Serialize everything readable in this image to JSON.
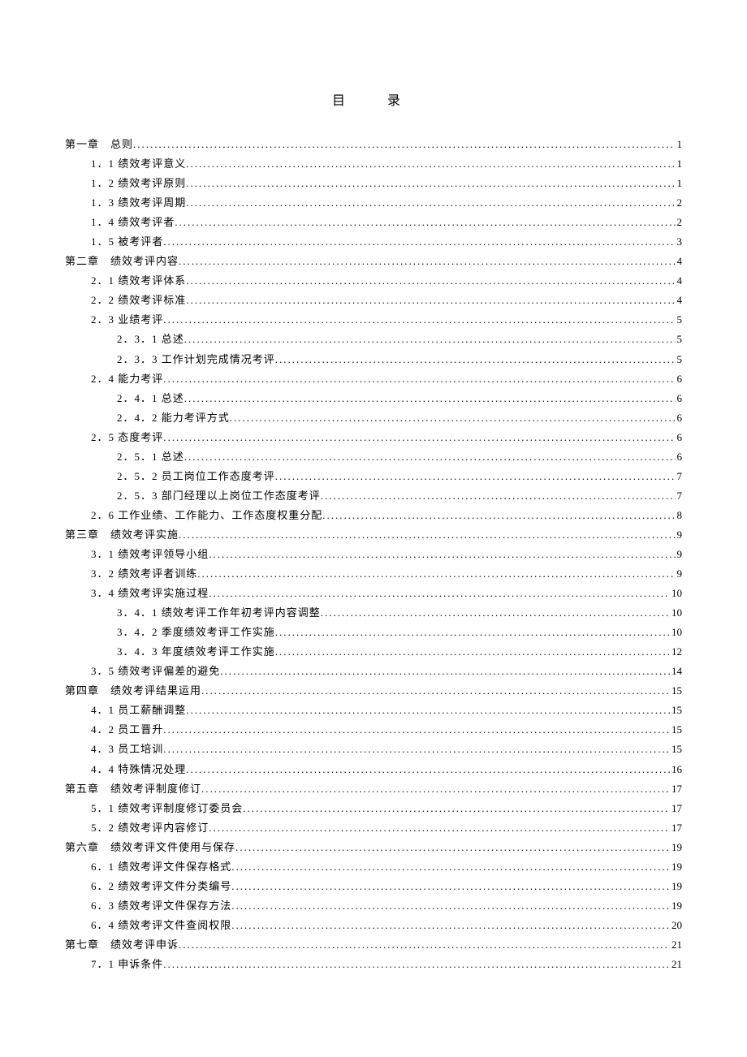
{
  "title": "目　录",
  "entries": [
    {
      "indent": 0,
      "label": "第一章　总则",
      "page": "1"
    },
    {
      "indent": 1,
      "label": "1．1 绩效考评意义",
      "page": "1"
    },
    {
      "indent": 1,
      "label": "1．2 绩效考评原则",
      "page": "1"
    },
    {
      "indent": 1,
      "label": "1．3 绩效考评周期",
      "page": "2"
    },
    {
      "indent": 1,
      "label": "1．4 绩效考评者",
      "page": "2"
    },
    {
      "indent": 1,
      "label": "1．5 被考评者",
      "page": "3"
    },
    {
      "indent": 0,
      "label": "第二章　绩效考评内容",
      "page": "4"
    },
    {
      "indent": 1,
      "label": "2．1 绩效考评体系",
      "page": "4"
    },
    {
      "indent": 1,
      "label": "2．2 绩效考评标准",
      "page": "4"
    },
    {
      "indent": 1,
      "label": "2．3 业绩考评",
      "page": "5"
    },
    {
      "indent": 2,
      "label": "2．3．1 总述",
      "page": "5"
    },
    {
      "indent": 2,
      "label": "2．3．3 工作计划完成情况考评",
      "page": "5"
    },
    {
      "indent": 1,
      "label": "2．4 能力考评",
      "page": "6"
    },
    {
      "indent": 2,
      "label": "2．4．1 总述",
      "page": "6"
    },
    {
      "indent": 2,
      "label": "2．4．2 能力考评方式",
      "page": "6"
    },
    {
      "indent": 1,
      "label": "2．5 态度考评",
      "page": "6"
    },
    {
      "indent": 2,
      "label": "2．5．1 总述",
      "page": "6"
    },
    {
      "indent": 2,
      "label": "2．5．2 员工岗位工作态度考评",
      "page": "7"
    },
    {
      "indent": 2,
      "label": "2．5．3 部门经理以上岗位工作态度考评",
      "page": "7"
    },
    {
      "indent": 1,
      "label": "2．6 工作业绩、工作能力、工作态度权重分配",
      "page": "8"
    },
    {
      "indent": 0,
      "label": "第三章　绩效考评实施",
      "page": "9"
    },
    {
      "indent": 1,
      "label": "3．1 绩效考评领导小组",
      "page": "9"
    },
    {
      "indent": 1,
      "label": "3．2 绩效考评者训练",
      "page": "9"
    },
    {
      "indent": 1,
      "label": "3．4 绩效考评实施过程",
      "page": "10"
    },
    {
      "indent": 2,
      "label": "3．4．1 绩效考评工作年初考评内容调整",
      "page": "10"
    },
    {
      "indent": 2,
      "label": "3．4．2 季度绩效考评工作实施",
      "page": "10"
    },
    {
      "indent": 2,
      "label": "3．4．3 年度绩效考评工作实施",
      "page": "12"
    },
    {
      "indent": 1,
      "label": "3．5 绩效考评偏差的避免",
      "page": "14"
    },
    {
      "indent": 0,
      "label": "第四章　绩效考评结果运用",
      "page": "15"
    },
    {
      "indent": 1,
      "label": "4．1 员工薪酬调整",
      "page": "15"
    },
    {
      "indent": 1,
      "label": "4．2 员工晋升",
      "page": "15"
    },
    {
      "indent": 1,
      "label": "4．3 员工培训",
      "page": "15"
    },
    {
      "indent": 1,
      "label": "4．4 特殊情况处理",
      "page": "16"
    },
    {
      "indent": 0,
      "label": "第五章　绩效考评制度修订",
      "page": "17"
    },
    {
      "indent": 1,
      "label": "5．1 绩效考评制度修订委员会",
      "page": "17"
    },
    {
      "indent": 1,
      "label": "5．2 绩效考评内容修订",
      "page": "17"
    },
    {
      "indent": 0,
      "label": "第六章　绩效考评文件使用与保存",
      "page": "19"
    },
    {
      "indent": 1,
      "label": "6．1 绩效考评文件保存格式",
      "page": "19"
    },
    {
      "indent": 1,
      "label": "6．2 绩效考评文件分类编号",
      "page": "19"
    },
    {
      "indent": 1,
      "label": "6．3 绩效考评文件保存方法",
      "page": "19"
    },
    {
      "indent": 1,
      "label": "6．4 绩效考评文件查阅权限",
      "page": "20"
    },
    {
      "indent": 0,
      "label": "第七章　绩效考评申诉",
      "page": "21"
    },
    {
      "indent": 1,
      "label": "7．1 申诉条件",
      "page": "21"
    }
  ]
}
